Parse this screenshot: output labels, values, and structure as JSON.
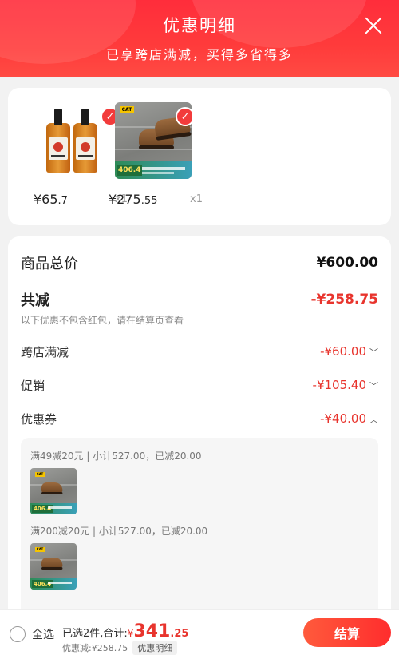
{
  "header": {
    "title": "优惠明细",
    "subtitle": "已享跨店满减，买得多省得多"
  },
  "products": [
    {
      "price_int": "¥65",
      "price_dec": ".7",
      "qty": "x1"
    },
    {
      "price_int": "¥275",
      "price_dec": ".55",
      "qty": "x1",
      "promo_price": "406.4"
    }
  ],
  "summary": {
    "total_label": "商品总价",
    "total_value": "¥600.00",
    "reduce_label": "共减",
    "reduce_value": "-¥258.75",
    "note": "以下优惠不包含红包，请在结算页查看",
    "lines": [
      {
        "label": "跨店满减",
        "value": "-¥60.00",
        "icon": "chevron-down-icon"
      },
      {
        "label": "促销",
        "value": "-¥105.40",
        "icon": "chevron-down-icon"
      },
      {
        "label": "优惠券",
        "value": "-¥40.00",
        "icon": "chevron-up-icon"
      }
    ]
  },
  "coupon_details": [
    {
      "rule": "满49减20元 | 小计527.00，已减20.00",
      "promo_price": "406.4"
    },
    {
      "rule": "满200减20元 | 小计527.00，已减20.00",
      "promo_price": "406.4"
    }
  ],
  "bottom_bar": {
    "select_all_label": "全选",
    "selected_prefix": "已选2件,合计:",
    "currency": "¥",
    "total_int": "341",
    "total_dec": ".25",
    "discount_text": "优惠减:¥258.75",
    "detail_label": "优惠明细",
    "checkout_label": "结算"
  },
  "colors": {
    "accent_red": "#e8342d",
    "header_red": "#ff2d3b"
  }
}
